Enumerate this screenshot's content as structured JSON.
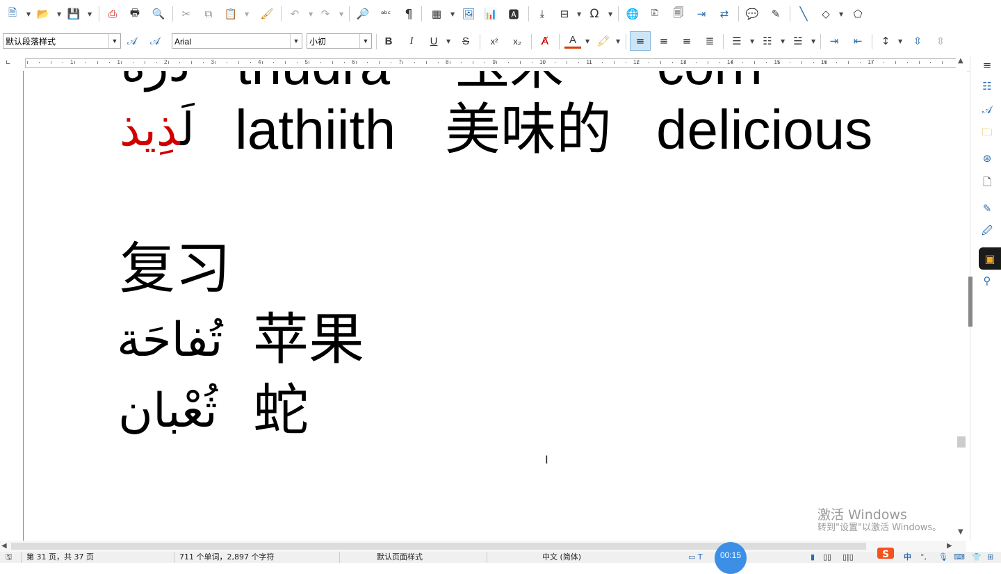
{
  "toolbar": {
    "paragraph_style": "默认段落样式",
    "font_name": "Arial",
    "font_size": "小初",
    "bold_label": "B",
    "italic_label": "I",
    "underline_label": "U",
    "strike_label": "S",
    "superscript_label": "x²",
    "subscript_label": "x₂",
    "font_color_label": "A",
    "accent_color": "#d83b01",
    "align_active_color": "#cde6f7"
  },
  "ruler": {
    "numbers": [
      "1",
      "1",
      "2",
      "3",
      "4",
      "5",
      "6",
      "7",
      "8",
      "9",
      "10",
      "11",
      "12",
      "13",
      "14",
      "15",
      "16",
      "17"
    ]
  },
  "document": {
    "row0": {
      "arabic": "ذُرَة",
      "translit": "thudra",
      "chinese": "玉米",
      "english": "corn"
    },
    "row1": {
      "arabic_black": "لَ",
      "arabic_red": "ذِيذ",
      "translit": "lathiith",
      "chinese": "美味的",
      "english": "delicious"
    },
    "review_heading": "复习",
    "review": [
      {
        "arabic": "تُفاحَة",
        "chinese": "苹果"
      },
      {
        "arabic": "ثُعْبان",
        "chinese": "蛇"
      }
    ]
  },
  "watermark": {
    "line1": "激活 Windows",
    "line2": "转到\"设置\"以激活 Windows。"
  },
  "timer": "00:15",
  "status": {
    "page": "第 31 页，共 37 页",
    "words": "711 个单词，2,897 个字符",
    "page_style": "默认页面样式",
    "language": "中文 (简体)"
  },
  "ime": {
    "mode": "中"
  }
}
